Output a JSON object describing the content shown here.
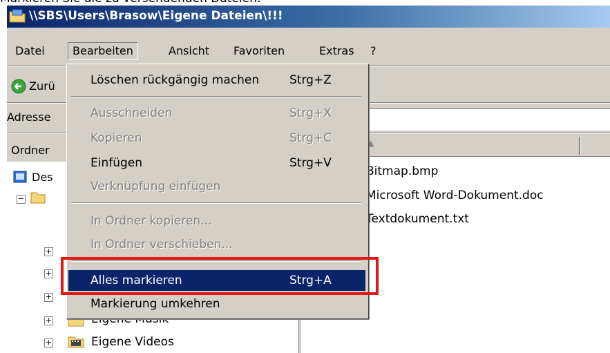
{
  "caption": "Markieren Sie die zu versendenden Dateien:",
  "window": {
    "title": "\\\\SBS\\Users\\Brasow\\Eigene Dateien\\!!!"
  },
  "menubar": [
    "Datei",
    "Bearbeiten",
    "Ansicht",
    "Favoriten",
    "Extras",
    "?"
  ],
  "toolbar": {
    "back_label": "Zurü"
  },
  "address": {
    "label": "Adresse"
  },
  "folder_pane": {
    "header": "Ordner",
    "desktop": "Des",
    "music": "Eigene Musik",
    "videos": "Eigene Videos"
  },
  "files": [
    "Bitmap.bmp",
    "Microsoft Word-Dokument.doc",
    "Textdokument.txt"
  ],
  "edit_menu": {
    "items": [
      {
        "label": "Löschen rückgängig machen",
        "shortcut": "Strg+Z"
      },
      {
        "label": "Ausschneiden",
        "shortcut": "Strg+X"
      },
      {
        "label": "Kopieren",
        "shortcut": "Strg+C"
      },
      {
        "label": "Einfügen",
        "shortcut": "Strg+V"
      },
      {
        "label": "Verknüpfung einfügen",
        "shortcut": ""
      },
      {
        "label": "In Ordner kopieren...",
        "shortcut": ""
      },
      {
        "label": "In Ordner verschieben...",
        "shortcut": ""
      },
      {
        "label": "Alles markieren",
        "shortcut": "Strg+A"
      },
      {
        "label": "Markierung umkehren",
        "shortcut": ""
      }
    ]
  },
  "colors": {
    "selection": "#0a246a",
    "highlight_frame": "#e01818",
    "face": "#d4d0c8"
  },
  "icons": [
    "folder-icon",
    "back-arrow-icon",
    "desktop-icon",
    "music-folder-icon",
    "video-folder-icon"
  ]
}
